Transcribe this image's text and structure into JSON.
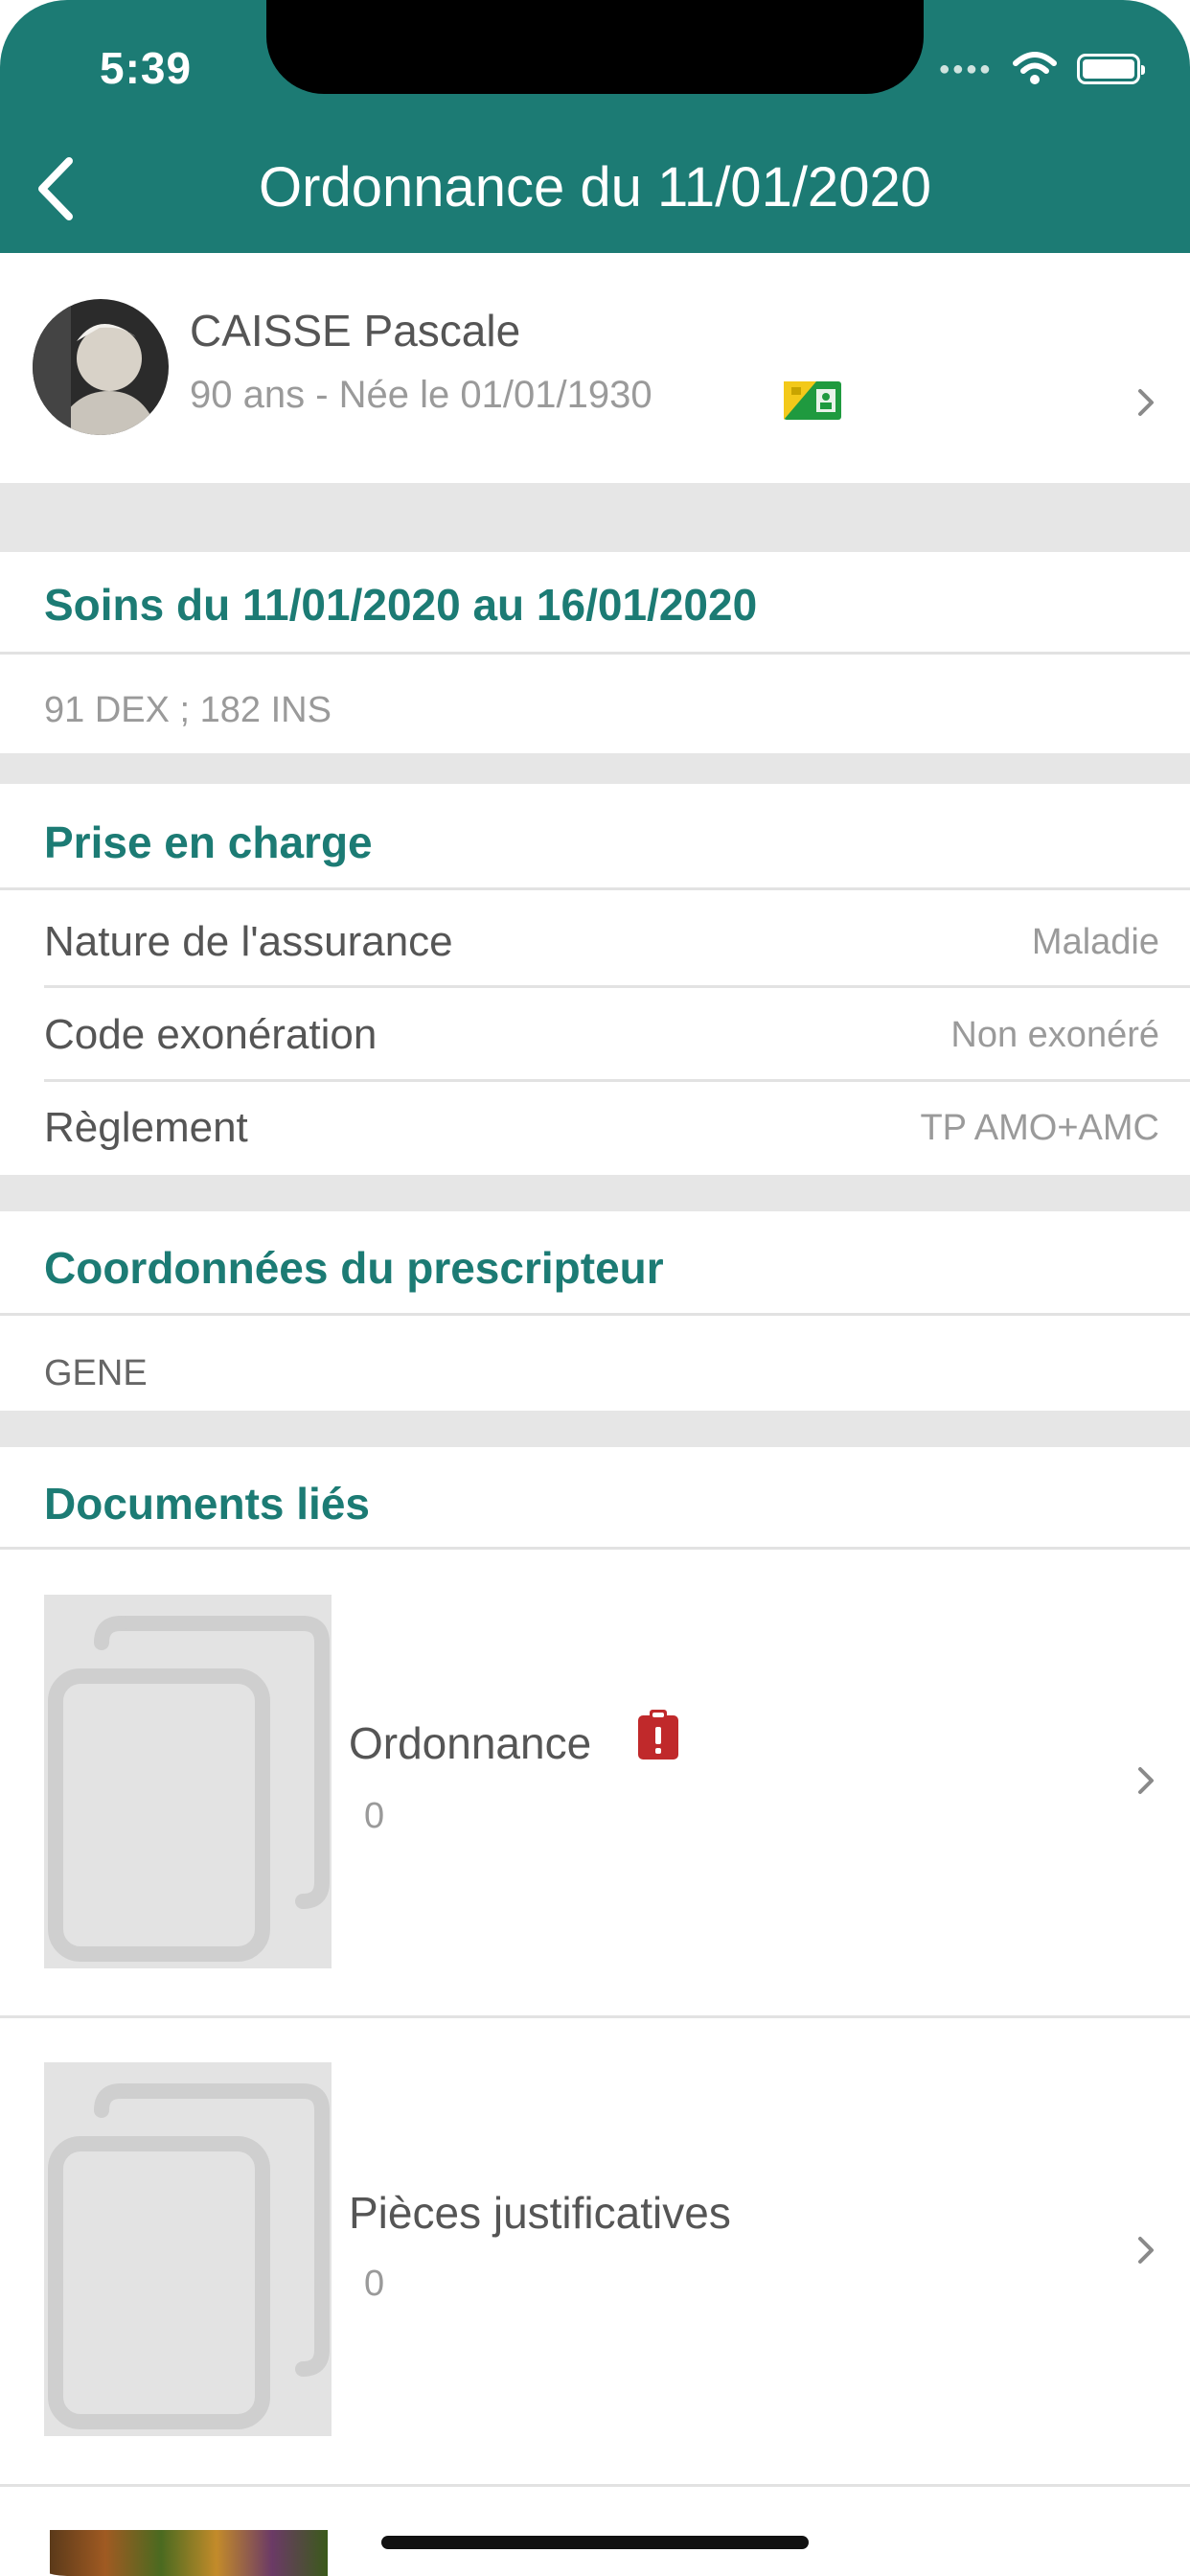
{
  "status_bar": {
    "time": "5:39"
  },
  "header": {
    "title": "Ordonnance du 11/01/2020",
    "back_icon": "chevron-left-icon"
  },
  "patient": {
    "name": "CAISSE Pascale",
    "info": "90 ans - Née le 01/01/1930",
    "card_icon": "vitale-card-icon"
  },
  "soins": {
    "title": "Soins du 11/01/2020 au 16/01/2020",
    "detail": "91 DEX ; 182 INS"
  },
  "prise_en_charge": {
    "title": "Prise en charge",
    "rows": [
      {
        "label": "Nature de l'assurance",
        "value": "Maladie"
      },
      {
        "label": "Code exonération",
        "value": "Non exonéré"
      },
      {
        "label": "Règlement",
        "value": "TP AMO+AMC"
      }
    ]
  },
  "prescripteur": {
    "title": "Coordonnées du prescripteur",
    "name": "GENE"
  },
  "documents": {
    "title": "Documents liés",
    "items": [
      {
        "title": "Ordonnance",
        "count": "0",
        "alert_icon": "clipboard-alert-icon"
      },
      {
        "title": "Pièces justificatives",
        "count": "0"
      }
    ]
  },
  "colors": {
    "accent": "#1c7b74",
    "alert": "#c0292b"
  }
}
